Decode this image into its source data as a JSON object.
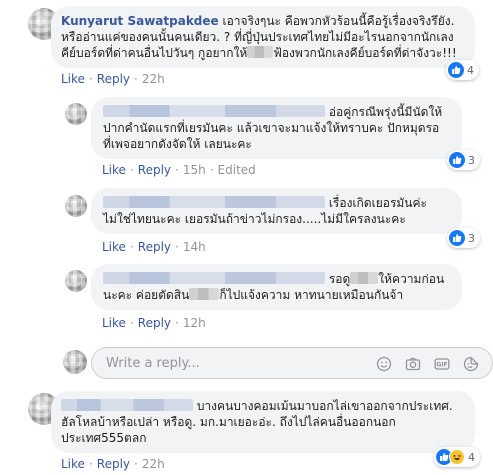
{
  "comments": [
    {
      "author": "Kunyarut Sawatpakdee",
      "text_part1": " เอาจริงๆนะ คือพวกหัวร้อนนี้คือรู้เรื่องจริงรึยัง. หรืออ่านแค่ของคนนั้นคนเดียว. ? ที่ญี่ปุ่นประเทศไทยไม่มีอะไรนอกจากนักเลงคีย์บอร์ดที่ด่าคนอื่นไปวันๆ กูอยากให้",
      "text_part2": "ฟ้องพวกนักเลงคีย์บอร์ดที่ด่าจังวะ!!!",
      "like_label": "Like",
      "reply_label": "Reply",
      "time": "22h",
      "reaction_count": "4"
    },
    {
      "text": "อ่อคู่กรณีพรุ่งนี้มีนัดให้ปากคำนัดแรกที่เยรมันคะ แล้วเขาจะมาแจ้งให้ทราบคะ ปักหมุดรอ ที่เพจอยากดังจัดให้ เลยนะคะ",
      "like_label": "Like",
      "reply_label": "Reply",
      "time": "15h",
      "edited_label": "Edited",
      "reaction_count": "3"
    },
    {
      "text": "เรื่องเกิดเยอรมันค่ะ ไม่ใช่ไทยนะคะ เยอรมันถ้าข่าวไม่กรอง.....ไม่มีใครลงนะคะ",
      "like_label": "Like",
      "reply_label": "Reply",
      "time": "14h",
      "reaction_count": "3"
    },
    {
      "text_part1": "รอดู",
      "text_part2": "ให้ความก่อนนะคะ ค่อยตัดสิน",
      "text_part3": "ก็ไปแจ้งความ หาทนายเหมือนกันจ้า",
      "like_label": "Like",
      "reply_label": "Reply",
      "time": "12h"
    },
    {
      "text": "บางคนบางคอมเม้นมาบอกไล่เขาออกจากประเทศ. ฮัลโหลบ้าหรือเปล่า หรือดู. มก.มาเยอะอ่ะ. ถึงไปไล่คนอื่นออกนอกประเทศ555ตลก",
      "like_label": "Like",
      "reply_label": "Reply",
      "time": "22h",
      "reaction_count": "4"
    }
  ],
  "reply_box": {
    "placeholder": "Write a reply..."
  },
  "icons": {
    "like": "like-icon",
    "haha": "haha-icon",
    "emoji": "smiley-icon",
    "camera": "camera-icon",
    "gif": "gif-icon",
    "sticker": "sticker-icon"
  },
  "colors": {
    "link": "#385898",
    "bubble": "#f2f3f5",
    "like_blue": "#1877f2",
    "meta": "#90949c"
  }
}
